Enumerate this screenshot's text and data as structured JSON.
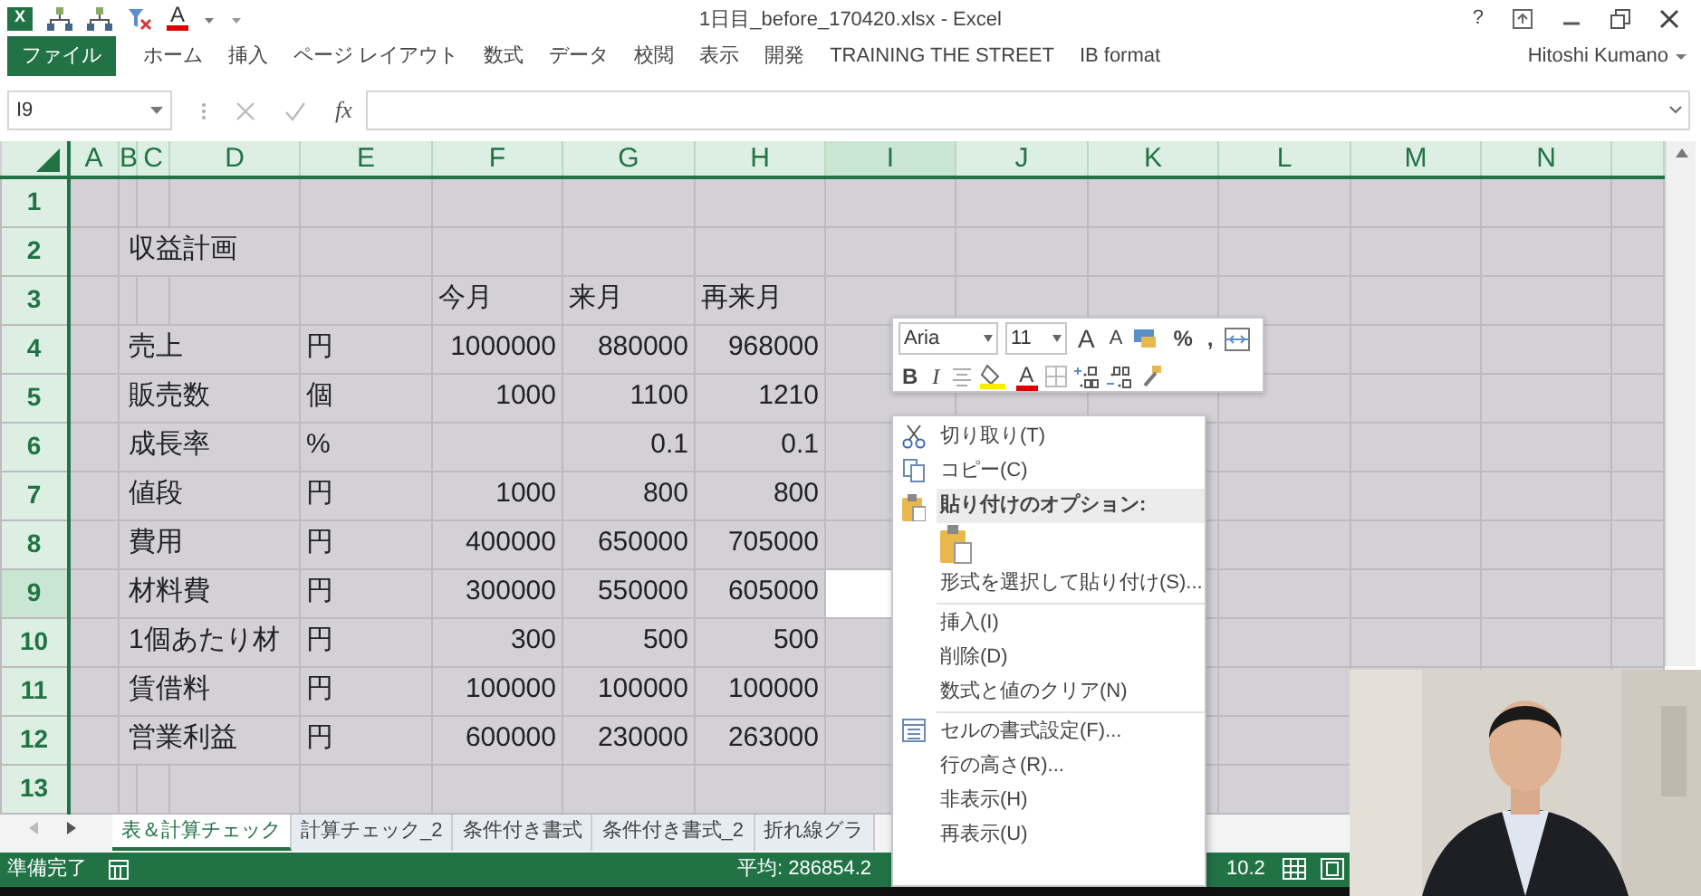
{
  "window": {
    "title": "1日目_before_170420.xlsx - Excel",
    "help_label": "?"
  },
  "quick_access": [
    {
      "kind": "excel",
      "label": "X"
    },
    {
      "kind": "org"
    },
    {
      "kind": "org"
    },
    {
      "kind": "filter_clear"
    },
    {
      "kind": "font_color",
      "label": "A"
    }
  ],
  "ribbon": {
    "file_tab": "ファイル",
    "tabs": [
      "ホーム",
      "挿入",
      "ページ レイアウト",
      "数式",
      "データ",
      "校閲",
      "表示",
      "開発",
      "TRAINING THE STREET",
      "IB format"
    ],
    "user": "Hitoshi Kumano"
  },
  "formula_bar": {
    "name_box": "I9",
    "fx_label": "fx"
  },
  "sheet": {
    "columns": [
      {
        "label": "A",
        "selected": false
      },
      {
        "label": "B",
        "selected": false
      },
      {
        "label": "C",
        "selected": false
      },
      {
        "label": "D",
        "selected": false
      },
      {
        "label": "E",
        "selected": false
      },
      {
        "label": "F",
        "selected": false
      },
      {
        "label": "G",
        "selected": false
      },
      {
        "label": "H",
        "selected": false
      },
      {
        "label": "I",
        "selected": true
      },
      {
        "label": "J",
        "selected": false
      },
      {
        "label": "K",
        "selected": false
      },
      {
        "label": "L",
        "selected": false
      },
      {
        "label": "M",
        "selected": false
      },
      {
        "label": "N",
        "selected": false
      }
    ],
    "rows": [
      {
        "number": "1",
        "kind": "blank",
        "selected": false
      },
      {
        "number": "2",
        "kind": "data",
        "selected": false,
        "label": "収益計画"
      },
      {
        "number": "3",
        "kind": "header",
        "selected": false,
        "col_f": "今月",
        "col_g": "来月",
        "col_h": "再来月"
      },
      {
        "number": "4",
        "kind": "data",
        "selected": false,
        "label": "売上",
        "unit": "円",
        "col_f": "1000000",
        "col_g": "880000",
        "col_h": "968000"
      },
      {
        "number": "5",
        "kind": "data",
        "selected": false,
        "label": "販売数",
        "unit": "個",
        "col_f": "1000",
        "col_g": "1100",
        "col_h": "1210"
      },
      {
        "number": "6",
        "kind": "data",
        "selected": false,
        "label": "成長率",
        "unit": "%",
        "col_g": "0.1",
        "col_h": "0.1"
      },
      {
        "number": "7",
        "kind": "data",
        "selected": false,
        "label": "値段",
        "unit": "円",
        "col_f": "1000",
        "col_g": "800",
        "col_h": "800"
      },
      {
        "number": "8",
        "kind": "data",
        "selected": false,
        "label": "費用",
        "unit": "円",
        "col_f": "400000",
        "col_g": "650000",
        "col_h": "705000"
      },
      {
        "number": "9",
        "kind": "data",
        "selected": true,
        "label": "材料費",
        "unit": "円",
        "col_f": "300000",
        "col_g": "550000",
        "col_h": "605000"
      },
      {
        "number": "10",
        "kind": "data",
        "selected": false,
        "label": "1個あたり材",
        "unit": "円",
        "col_f": "300",
        "col_g": "500",
        "col_h": "500"
      },
      {
        "number": "11",
        "kind": "data",
        "selected": false,
        "label": "賃借料",
        "unit": "円",
        "col_f": "100000",
        "col_g": "100000",
        "col_h": "100000"
      },
      {
        "number": "12",
        "kind": "data",
        "selected": false,
        "label": "営業利益",
        "unit": "円",
        "col_f": "600000",
        "col_g": "230000",
        "col_h": "263000"
      },
      {
        "number": "13",
        "kind": "blank",
        "selected": false
      }
    ]
  },
  "sheet_tabs": [
    {
      "label": "表＆計算チェック",
      "selected": true
    },
    {
      "label": "計算チェック_2",
      "selected": false
    },
    {
      "label": "条件付き書式",
      "selected": false
    },
    {
      "label": "条件付き書式_2",
      "selected": false
    },
    {
      "label": "折れ線グラ",
      "selected": false
    }
  ],
  "status_bar": {
    "ready": "準備完了",
    "average": "平均: 286854.2",
    "value_tail": "10.2"
  },
  "mini_toolbar": {
    "font": "Aria",
    "size": "11",
    "row_1": [
      {
        "kind": "grow_font",
        "label": "A"
      },
      {
        "kind": "shrink_font",
        "label": "A"
      },
      {
        "kind": "number_format"
      },
      {
        "kind": "text",
        "label": "%"
      },
      {
        "kind": "text",
        "label": ","
      },
      {
        "kind": "merge"
      }
    ],
    "row_2": [
      {
        "kind": "bold",
        "label": "B"
      },
      {
        "kind": "italic",
        "label": "I"
      },
      {
        "kind": "align"
      },
      {
        "kind": "fill_color"
      },
      {
        "kind": "font_color",
        "label": "A"
      },
      {
        "kind": "borders"
      },
      {
        "kind": "increase_decimal"
      },
      {
        "kind": "decrease_decimal"
      },
      {
        "kind": "painter"
      }
    ]
  },
  "context_menu": [
    {
      "kind": "cut",
      "label": "切り取り(T)"
    },
    {
      "kind": "copy",
      "label": "コピー(C)"
    },
    {
      "kind": "header",
      "label": "貼り付けのオプション:"
    },
    {
      "kind": "paste_options"
    },
    {
      "kind": "item",
      "label": "形式を選択して貼り付け(S)..."
    },
    {
      "kind": "separator"
    },
    {
      "kind": "item",
      "label": "挿入(I)"
    },
    {
      "kind": "item",
      "label": "削除(D)"
    },
    {
      "kind": "item",
      "label": "数式と値のクリア(N)"
    },
    {
      "kind": "separator"
    },
    {
      "kind": "format_cells",
      "label": "セルの書式設定(F)..."
    },
    {
      "kind": "item",
      "label": "行の高さ(R)..."
    },
    {
      "kind": "item",
      "label": "非表示(H)"
    },
    {
      "kind": "item",
      "label": "再表示(U)"
    }
  ]
}
